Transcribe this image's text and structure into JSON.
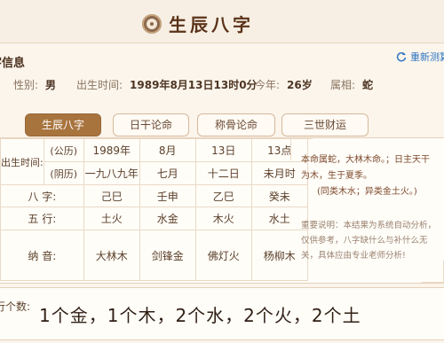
{
  "header": {
    "title": "生辰八字",
    "icon": "taiji-icon"
  },
  "info_section": {
    "title": "八字信息",
    "refresh_label": "重新测算",
    "gender_label": "性别:",
    "gender": "男",
    "birth_label": "出生时间:",
    "birth": "1989年8月13日13时0分",
    "age_label": "今年:",
    "age": "26岁",
    "zodiac_label": "属相:",
    "zodiac": "蛇"
  },
  "tabs": [
    {
      "label": "生辰八字",
      "active": true
    },
    {
      "label": "日干论命",
      "active": false
    },
    {
      "label": "称骨论命",
      "active": false
    },
    {
      "label": "三世财运",
      "active": false
    }
  ],
  "table": {
    "birth_time_label": "出生时间:",
    "solar_label": "(公历)",
    "lunar_label": "(阴历)",
    "solar": [
      "1989年",
      "8月",
      "13日",
      "13点"
    ],
    "lunar": [
      "一九八九年",
      "七月",
      "十二日",
      "未月时"
    ],
    "bazi_label": "八 字:",
    "bazi": [
      "己巳",
      "壬申",
      "乙巳",
      "癸未"
    ],
    "wuxing_label": "五 行:",
    "wuxing": [
      "土火",
      "水金",
      "木火",
      "水土"
    ],
    "nayin_label": "纳 音:",
    "nayin": [
      "大林木",
      "剑锋金",
      "佛灯火",
      "杨柳木"
    ]
  },
  "side_note": {
    "line1": "本命属蛇，大林木命。；日主天干为木，生于夏季。",
    "line2": "(同类木水；异类金土火。)",
    "disclaimer": "重要说明：本结果为系统自动分析，仅供参考，八字缺什么与补什么无关，具体应由专业老师分析!"
  },
  "wuxing_count": {
    "label": "五行个数:",
    "value": "1个金，1个木，2个水，2个火，2个土"
  }
}
